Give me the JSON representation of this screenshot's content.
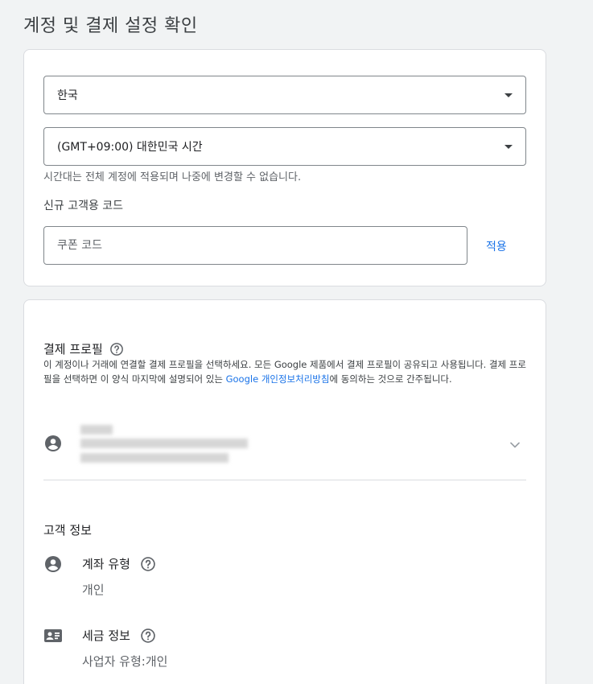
{
  "page": {
    "title": "계정 및 결제 설정 확인"
  },
  "account_settings": {
    "country": {
      "value": "한국"
    },
    "timezone": {
      "value": "(GMT+09:00) 대한민국 시간",
      "hint": "시간대는 전체 계정에 적용되며 나중에 변경할 수 없습니다."
    },
    "coupon": {
      "label": "신규 고객용 코드",
      "placeholder": "쿠폰 코드",
      "apply_label": "적용"
    }
  },
  "payments_profile": {
    "title": "결제 프로필",
    "desc_part1": "이 계정이나 거래에 연결할 결제 프로필을 선택하세요. 모든 Google 제품에서 결제 프로필이 공유되고 사용됩니다. 결제 프로필을 선택하면 이 양식 마지막에 설명되어 있는 ",
    "desc_link": "Google 개인정보처리방침",
    "desc_part2": "에 동의하는 것으로 간주됩니다."
  },
  "customer_info": {
    "title": "고객 정보",
    "account_type": {
      "label": "계좌 유형",
      "value": "개인"
    },
    "tax_info": {
      "label": "세금 정보",
      "value": "사업자 유형:개인"
    }
  },
  "colors": {
    "accent": "#1a73e8",
    "icon": "#5f6368",
    "border": "#80868b"
  },
  "icons": [
    "caret-down-icon",
    "help-icon",
    "account-circle-icon",
    "chevron-down-icon",
    "contact-card-icon"
  ]
}
